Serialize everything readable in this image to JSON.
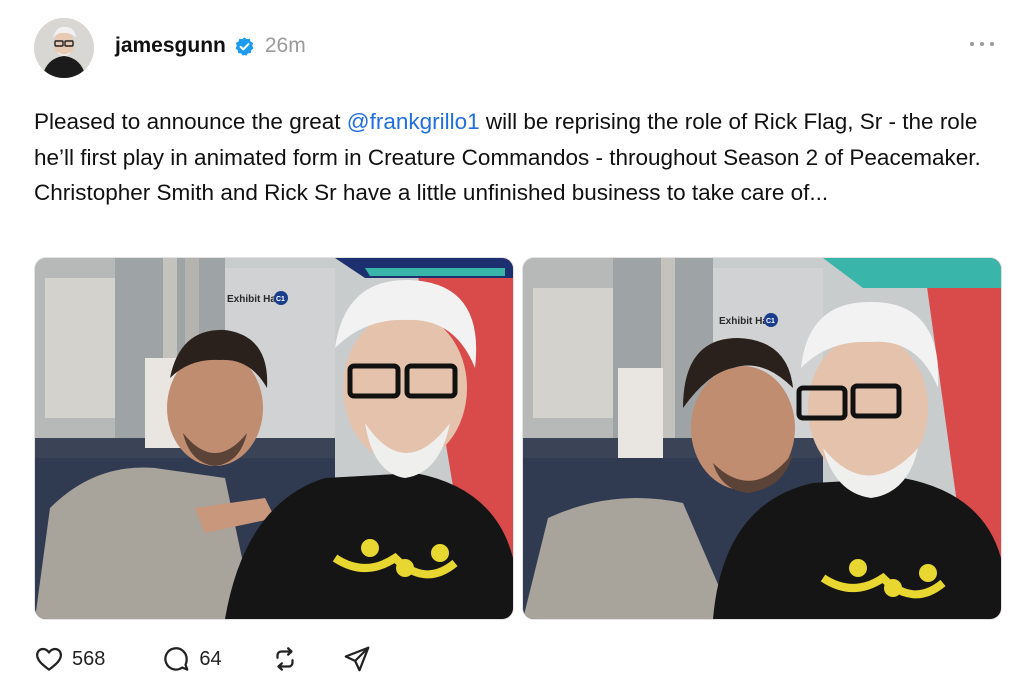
{
  "post": {
    "username": "jamesgunn",
    "time": "26m",
    "text_before": "Pleased to announce the great ",
    "mention": "@frankgrillo1",
    "text_after": " will be reprising the role of Rick Flag, Sr - the role he’ll first play in animated form in Creature Commandos - throughout Season 2 of Peacemaker. Christopher Smith and Rick Sr have a little unfinished business to take care of..."
  },
  "photos": {
    "sign_text": "Exhibit Hall",
    "sign_badge": "C1"
  },
  "actions": {
    "likes": "568",
    "comments": "64"
  },
  "icons": {
    "verified": "verified-badge-icon",
    "more": "more-options-icon",
    "like": "heart-icon",
    "comment": "comment-bubble-icon",
    "repost": "repost-icon",
    "share": "send-icon"
  },
  "colors": {
    "mention": "#1f6fe0",
    "verified": "#1d9bf0",
    "meta": "#9a9a9a"
  }
}
